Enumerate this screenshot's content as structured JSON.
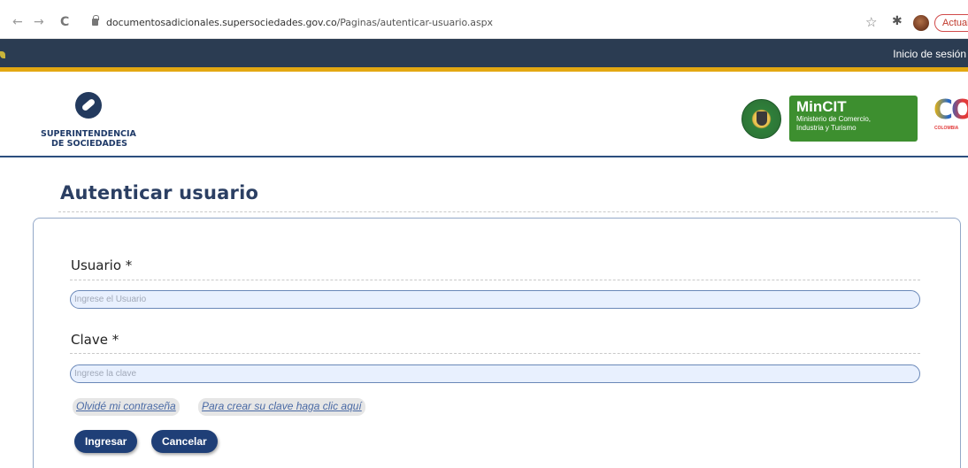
{
  "browser": {
    "back": "←",
    "forward": "→",
    "reload": "C",
    "url_host": "documentosadicionales.supersociedades.gov.co",
    "url_path": "/Paginas/autenticar-usuario.aspx",
    "star_icon": "☆",
    "extensions_icon": "✱",
    "update_label": "Actual"
  },
  "topbar": {
    "login_label": "Inicio de sesión",
    "bg_color": "#2b3c52",
    "accent_color": "#e3a812"
  },
  "header": {
    "ss_name_line1": "SUPERINTENDENCIA",
    "ss_name_line2": "DE SOCIEDADES",
    "mincit_title": "MinCIT",
    "mincit_sub1": "Ministerio de Comercio,",
    "mincit_sub2": "Industria y Turismo",
    "colombia_co": "CO",
    "colombia_word": "COLOMBIA"
  },
  "page": {
    "title": "Autenticar usuario"
  },
  "form": {
    "user_label": "Usuario *",
    "user_placeholder": "Ingrese el Usuario",
    "password_label": "Clave *",
    "password_placeholder": "Ingrese la clave",
    "forgot_link": "Olvidé mi contraseña",
    "create_link": "Para crear su clave haga clic aquí",
    "submit_label": "Ingresar",
    "cancel_label": "Cancelar",
    "button_color": "#1f3f77",
    "input_bg": "#e8f0fe"
  }
}
